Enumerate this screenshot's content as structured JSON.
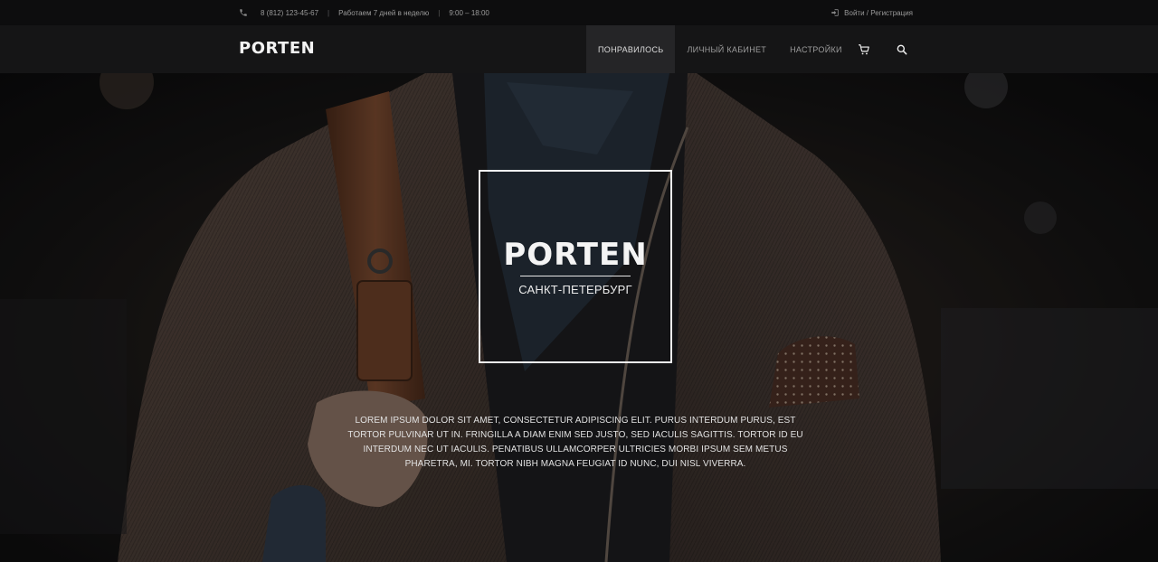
{
  "topbar": {
    "phone": "8 (812) 123-45-67",
    "separator": "|",
    "schedule": "Работаем 7 дней в неделю",
    "hours": "9:00 – 18:00",
    "auth": "Войти / Регистрация",
    "icons": {
      "phone": "phone-icon",
      "login": "login-icon"
    }
  },
  "header": {
    "logo": "PORTEN",
    "nav": [
      "ПОНРАВИЛОСЬ",
      "ЛИЧНЫЙ КАБИНЕТ",
      "НАСТРОЙКИ"
    ],
    "active_index": 0,
    "icons": {
      "cart": "cart-icon",
      "search": "search-icon"
    }
  },
  "hero": {
    "badge_title": "PORTEN",
    "badge_subtitle": "САНКТ-ПЕТЕРБУРГ",
    "text": "LOREM IPSUM DOLOR SIT AMET, CONSECTETUR ADIPISCING ELIT. PURUS INTERDUM PURUS, EST TORTOR PULVINAR UT IN. FRINGILLA A DIAM ENIM SED JUSTO, SED IACULIS SAGITTIS. TORTOR ID EU INTERDUM NEC UT IACULIS. PENATIBUS ULLAMCORPER ULTRICIES MORBI IPSUM SEM METUS PHARETRA, MI. TORTOR NIBH MAGNA FEUGIAT ID NUNC, DUI NISL VIVERRA."
  },
  "colors": {
    "topbar_bg": "#0d0d0e",
    "nav_bg": "#151516",
    "nav_active_bg": "#252527",
    "text_light": "#f3f3f3",
    "text_muted": "#9a9a9a"
  }
}
